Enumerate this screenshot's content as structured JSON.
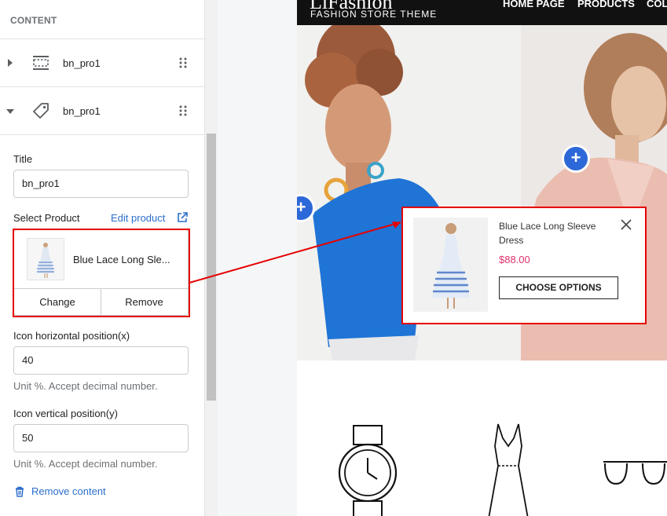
{
  "sidebar": {
    "section_title": "CONTENT",
    "blocks": [
      {
        "label": "bn_pro1",
        "icon": "section-icon",
        "expanded": false
      },
      {
        "label": "bn_pro1",
        "icon": "tag-icon",
        "expanded": true
      }
    ],
    "title_label": "Title",
    "title_value": "bn_pro1",
    "select_product_label": "Select Product",
    "edit_product_link": "Edit product",
    "product_name": "Blue Lace Long Sle...",
    "change_button": "Change",
    "remove_button": "Remove",
    "x_label": "Icon horizontal position(x)",
    "x_value": "40",
    "x_help": "Unit %. Accept decimal number.",
    "y_label": "Icon vertical position(y)",
    "y_value": "50",
    "y_help": "Unit %. Accept decimal number.",
    "remove_content": "Remove content"
  },
  "preview": {
    "logo": "LiFashion",
    "logo_sub": "FASHION STORE THEME",
    "nav": [
      "HOME PAGE",
      "PRODUCTS",
      "COL"
    ],
    "hotspot_symbol": "+",
    "popup": {
      "title": "Blue Lace Long Sleeve Dress",
      "price": "$88.00",
      "button": "CHOOSE OPTIONS"
    }
  },
  "colors": {
    "accent_link": "#2c6ecb",
    "highlight": "#e60000",
    "hotspot": "#2d68d8",
    "price": "#e0306d"
  }
}
